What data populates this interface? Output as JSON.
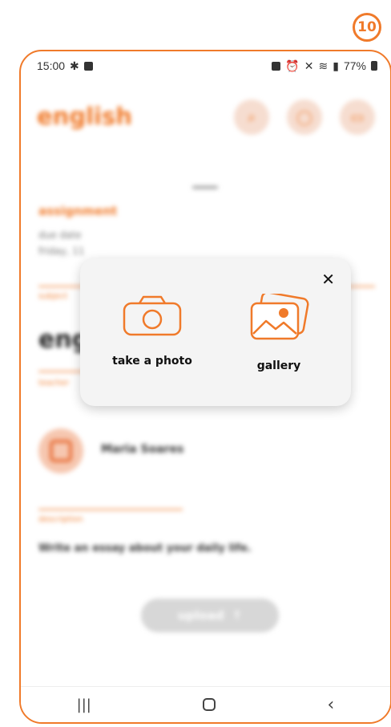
{
  "step_badge": "10",
  "status_bar": {
    "time": "15:00",
    "battery": "77%"
  },
  "header": {
    "title": "english"
  },
  "assignment": {
    "section_title": "assignment",
    "due_label": "due date",
    "due_value": "friday, 11",
    "subject_label": "subject",
    "subject_value": "english",
    "teacher_label": "teacher",
    "teacher_name": "Maria Soares",
    "description_label": "description",
    "description_text": "Write an essay about your daily life."
  },
  "upload_button": {
    "label": "upload",
    "icon": "arrow-up-icon"
  },
  "popup": {
    "close_icon": "close-icon",
    "options": [
      {
        "label": "take a photo",
        "icon": "camera-icon"
      },
      {
        "label": "gallery",
        "icon": "gallery-icon"
      }
    ]
  },
  "colors": {
    "accent": "#f07a2a",
    "accent_light": "#f6ddd0",
    "popup_bg": "#f4f4f4"
  }
}
